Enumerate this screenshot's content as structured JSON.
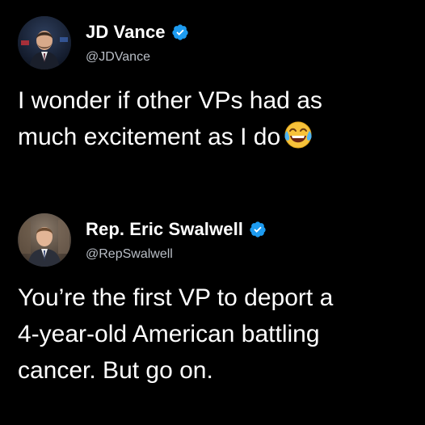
{
  "tweets": [
    {
      "name": "JD Vance",
      "handle": "@JDVance",
      "verified": true,
      "text": "I wonder if other VPs had as\nmuch excitement as I do",
      "emoji": "face-with-tears-of-joy-emoji"
    },
    {
      "name": "Rep. Eric Swalwell",
      "handle": "@RepSwalwell",
      "verified": true,
      "text": "You’re the first VP to deport a\n4-year-old American battling\ncancer. But go on."
    }
  ],
  "colors": {
    "background": "#000000",
    "text": "#ffffff",
    "handle": "#b9bec6",
    "verified_badge": "#1d9bf0"
  },
  "icons": {
    "verified": "verified-badge-icon",
    "avatar": "profile-photo"
  }
}
